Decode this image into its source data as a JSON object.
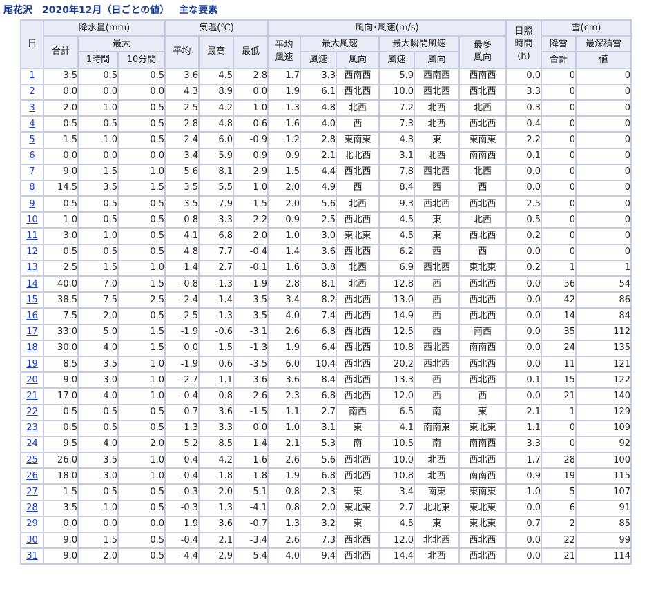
{
  "title": {
    "station": "尾花沢",
    "period": "2020年12月（日ごとの値）",
    "subtitle": "主な要素"
  },
  "headers": {
    "day": "日",
    "precip": "降水量(mm)",
    "precip_total": "合計",
    "precip_max": "最大",
    "precip_1h": "1時間",
    "precip_10m": "10分間",
    "temp": "気温(℃)",
    "temp_avg": "平均",
    "temp_max": "最高",
    "temp_min": "最低",
    "wind": "風向･風速(m/s)",
    "wind_avg1": "平均",
    "wind_avg2": "風速",
    "wind_max": "最大風速",
    "wind_gust": "最大瞬間風速",
    "wind_mostdir1": "最多",
    "wind_mostdir2": "風向",
    "speed": "風速",
    "direction": "風向",
    "sun1": "日照",
    "sun2": "時間",
    "sun3": "(h)",
    "snow": "雪(cm)",
    "snowfall1": "降雪",
    "snowfall2": "合計",
    "snowdepth1": "最深積雪",
    "snowdepth2": "値"
  },
  "rows": [
    [
      "1",
      "3.5",
      "0.5",
      "0.5",
      "3.6",
      "4.5",
      "2.8",
      "1.7",
      "3.3",
      "西南西",
      "5.9",
      "西南西",
      "西南西",
      "0.0",
      "0",
      "0"
    ],
    [
      "2",
      "0.0",
      "0.0",
      "0.0",
      "4.3",
      "8.9",
      "0.0",
      "1.9",
      "6.1",
      "西北西",
      "10.0",
      "西北西",
      "西北西",
      "3.3",
      "0",
      "0"
    ],
    [
      "3",
      "2.0",
      "1.0",
      "0.5",
      "2.5",
      "4.2",
      "1.0",
      "1.3",
      "4.8",
      "北西",
      "7.2",
      "北西",
      "北西",
      "0.3",
      "0",
      "0"
    ],
    [
      "4",
      "0.5",
      "0.5",
      "0.5",
      "2.8",
      "4.8",
      "0.6",
      "1.6",
      "4.0",
      "西",
      "7.3",
      "北西",
      "西北西",
      "0.4",
      "0",
      "0"
    ],
    [
      "5",
      "1.5",
      "1.0",
      "0.5",
      "2.4",
      "6.0",
      "-0.9",
      "1.2",
      "2.8",
      "東南東",
      "4.3",
      "東",
      "東南東",
      "2.2",
      "0",
      "0"
    ],
    [
      "6",
      "0.0",
      "0.0",
      "0.0",
      "3.4",
      "5.9",
      "0.9",
      "0.9",
      "2.1",
      "北北西",
      "3.1",
      "北西",
      "南南西",
      "0.1",
      "0",
      "0"
    ],
    [
      "7",
      "9.0",
      "1.5",
      "1.0",
      "5.6",
      "8.1",
      "2.9",
      "1.5",
      "4.4",
      "西北西",
      "7.8",
      "西北西",
      "北西",
      "0.0",
      "0",
      "0"
    ],
    [
      "8",
      "14.5",
      "3.5",
      "1.5",
      "3.5",
      "5.5",
      "1.0",
      "2.0",
      "4.9",
      "西",
      "8.4",
      "西",
      "西",
      "0.0",
      "0",
      "0"
    ],
    [
      "9",
      "0.5",
      "0.5",
      "0.5",
      "3.5",
      "7.9",
      "-1.5",
      "2.0",
      "5.6",
      "北西",
      "9.3",
      "西北西",
      "西北西",
      "2.5",
      "0",
      "0"
    ],
    [
      "10",
      "1.0",
      "0.5",
      "0.5",
      "0.8",
      "3.3",
      "-2.2",
      "0.9",
      "2.5",
      "西北西",
      "4.5",
      "東",
      "北西",
      "0.5",
      "0",
      "0"
    ],
    [
      "11",
      "3.0",
      "1.0",
      "0.5",
      "4.1",
      "6.8",
      "2.0",
      "1.0",
      "3.0",
      "東北東",
      "4.5",
      "東",
      "西北西",
      "0.2",
      "0",
      "0"
    ],
    [
      "12",
      "0.5",
      "0.5",
      "0.5",
      "4.8",
      "7.7",
      "-0.4",
      "1.4",
      "3.6",
      "西北西",
      "6.2",
      "西",
      "西",
      "0.0",
      "0",
      "0"
    ],
    [
      "13",
      "2.5",
      "1.5",
      "1.0",
      "1.4",
      "2.7",
      "-0.1",
      "1.6",
      "3.8",
      "北西",
      "6.9",
      "西北西",
      "東北東",
      "0.2",
      "1",
      "1"
    ],
    [
      "14",
      "40.0",
      "7.0",
      "1.5",
      "-0.8",
      "1.3",
      "-1.9",
      "2.8",
      "8.1",
      "北西",
      "12.8",
      "西",
      "西北西",
      "0.0",
      "56",
      "54"
    ],
    [
      "15",
      "38.5",
      "7.5",
      "2.5",
      "-2.4",
      "-1.4",
      "-3.5",
      "3.4",
      "8.2",
      "西北西",
      "13.0",
      "西",
      "西北西",
      "0.0",
      "42",
      "86"
    ],
    [
      "16",
      "7.5",
      "2.0",
      "0.5",
      "-2.5",
      "-1.3",
      "-3.5",
      "4.0",
      "7.4",
      "西北西",
      "14.9",
      "西",
      "西北西",
      "0.0",
      "14",
      "84"
    ],
    [
      "17",
      "33.0",
      "5.0",
      "1.5",
      "-1.9",
      "-0.6",
      "-3.1",
      "2.6",
      "6.8",
      "西北西",
      "12.5",
      "西",
      "南西",
      "0.0",
      "35",
      "112"
    ],
    [
      "18",
      "30.0",
      "4.0",
      "1.5",
      "0.0",
      "1.5",
      "-1.3",
      "1.9",
      "6.4",
      "西北西",
      "10.8",
      "西北西",
      "南南西",
      "0.0",
      "24",
      "135"
    ],
    [
      "19",
      "8.5",
      "3.5",
      "1.0",
      "-1.9",
      "0.6",
      "-3.5",
      "6.0",
      "10.4",
      "西北西",
      "20.2",
      "西北西",
      "西北西",
      "0.0",
      "11",
      "121"
    ],
    [
      "20",
      "9.0",
      "3.0",
      "1.0",
      "-2.7",
      "-1.1",
      "-3.6",
      "3.6",
      "8.4",
      "西北西",
      "13.3",
      "西",
      "西北西",
      "0.1",
      "15",
      "122"
    ],
    [
      "21",
      "17.0",
      "4.0",
      "1.0",
      "-0.4",
      "0.8",
      "-2.6",
      "2.3",
      "6.8",
      "西北西",
      "12.0",
      "西",
      "西",
      "0.0",
      "21",
      "140"
    ],
    [
      "22",
      "0.5",
      "0.5",
      "0.5",
      "0.7",
      "3.6",
      "-1.5",
      "1.1",
      "2.7",
      "南西",
      "6.5",
      "南",
      "東",
      "2.1",
      "1",
      "129"
    ],
    [
      "23",
      "0.5",
      "0.5",
      "0.5",
      "1.3",
      "3.3",
      "0.0",
      "1.0",
      "3.1",
      "東",
      "4.1",
      "南南東",
      "東北東",
      "1.1",
      "0",
      "109"
    ],
    [
      "24",
      "9.5",
      "4.0",
      "2.0",
      "5.2",
      "8.5",
      "1.4",
      "2.1",
      "5.3",
      "南",
      "10.5",
      "南",
      "南南西",
      "3.3",
      "0",
      "92"
    ],
    [
      "25",
      "26.0",
      "3.5",
      "1.0",
      "0.4",
      "4.2",
      "-1.6",
      "2.6",
      "5.6",
      "西北西",
      "10.0",
      "北西",
      "西北西",
      "1.7",
      "28",
      "100"
    ],
    [
      "26",
      "18.0",
      "3.0",
      "1.0",
      "-0.4",
      "1.8",
      "-1.8",
      "1.9",
      "6.8",
      "西北西",
      "10.8",
      "北西",
      "南南西",
      "0.9",
      "19",
      "115"
    ],
    [
      "27",
      "1.5",
      "0.5",
      "0.5",
      "-0.3",
      "2.0",
      "-5.1",
      "0.8",
      "2.3",
      "東",
      "3.4",
      "南東",
      "東南東",
      "1.0",
      "5",
      "107"
    ],
    [
      "28",
      "3.5",
      "1.0",
      "0.5",
      "-0.3",
      "1.3",
      "-4.1",
      "0.8",
      "2.0",
      "東北東",
      "2.7",
      "北北東",
      "東北東",
      "0.0",
      "6",
      "91"
    ],
    [
      "29",
      "0.0",
      "0.0",
      "0.0",
      "1.9",
      "3.6",
      "-0.7",
      "1.3",
      "3.2",
      "東",
      "4.5",
      "東",
      "東北東",
      "0.7",
      "2",
      "85"
    ],
    [
      "30",
      "9.0",
      "1.5",
      "0.5",
      "-0.4",
      "2.1",
      "-3.4",
      "2.6",
      "7.3",
      "西北西",
      "12.0",
      "北北西",
      "西北西",
      "0.0",
      "22",
      "99"
    ],
    [
      "31",
      "9.0",
      "2.0",
      "0.5",
      "-4.4",
      "-2.9",
      "-5.4",
      "4.0",
      "9.4",
      "西北西",
      "14.4",
      "北西",
      "西北西",
      "0.0",
      "21",
      "114"
    ]
  ]
}
